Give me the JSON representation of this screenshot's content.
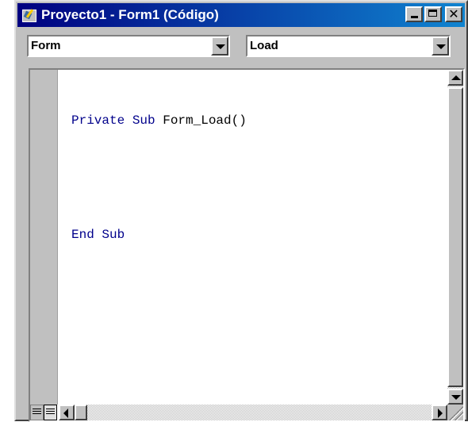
{
  "window": {
    "title": "Proyecto1 - Form1 (Código)",
    "title_bar_colors": [
      "#000080",
      "#1084d0"
    ]
  },
  "object_combo": {
    "value": "Form"
  },
  "procedure_combo": {
    "value": "Load"
  },
  "code": {
    "lines": [
      {
        "keyword": "Private Sub ",
        "text": "Form_Load()"
      },
      {
        "keyword": "",
        "text": ""
      },
      {
        "keyword": "End Sub",
        "text": ""
      }
    ],
    "keyword_color": "#00008b"
  },
  "icons": {
    "app": "vb-code-window-icon",
    "minimize": "minimize-icon",
    "maximize": "maximize-icon",
    "close": "close-icon"
  }
}
